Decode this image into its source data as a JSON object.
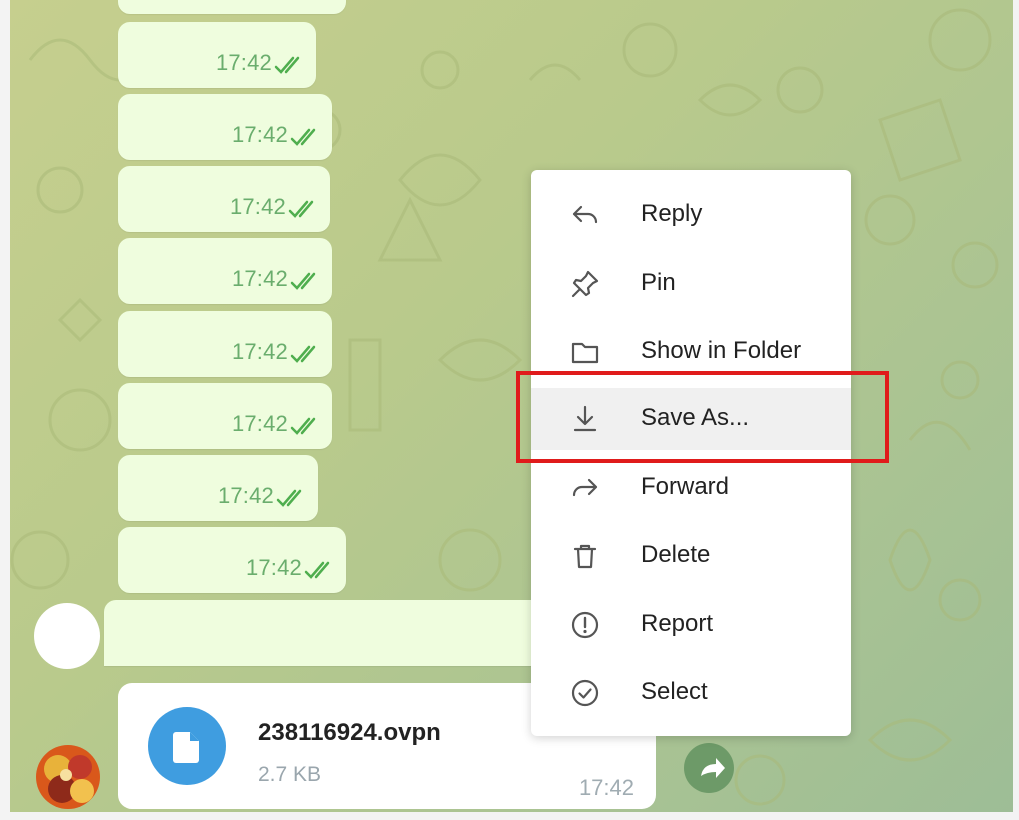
{
  "messages": {
    "times": [
      "17:42",
      "17:42",
      "17:42",
      "17:42",
      "17:42",
      "17:42",
      "17:42",
      "17:42"
    ]
  },
  "file_message": {
    "name": "238116924.ovpn",
    "size": "2.7 KB",
    "time": "17:42"
  },
  "context_menu": {
    "items": [
      {
        "label": "Reply",
        "icon": "reply-icon"
      },
      {
        "label": "Pin",
        "icon": "pin-icon"
      },
      {
        "label": "Show in Folder",
        "icon": "folder-icon"
      },
      {
        "label": "Save As...",
        "icon": "download-icon"
      },
      {
        "label": "Forward",
        "icon": "forward-icon"
      },
      {
        "label": "Delete",
        "icon": "trash-icon"
      },
      {
        "label": "Report",
        "icon": "report-icon"
      },
      {
        "label": "Select",
        "icon": "select-check-icon"
      }
    ],
    "highlighted_label": "Save As..."
  },
  "colors": {
    "bubble_out": "#effdde",
    "tick_green": "#4fae4e",
    "file_icon_blue": "#3f9de0",
    "highlight_red": "#e01b1b"
  }
}
